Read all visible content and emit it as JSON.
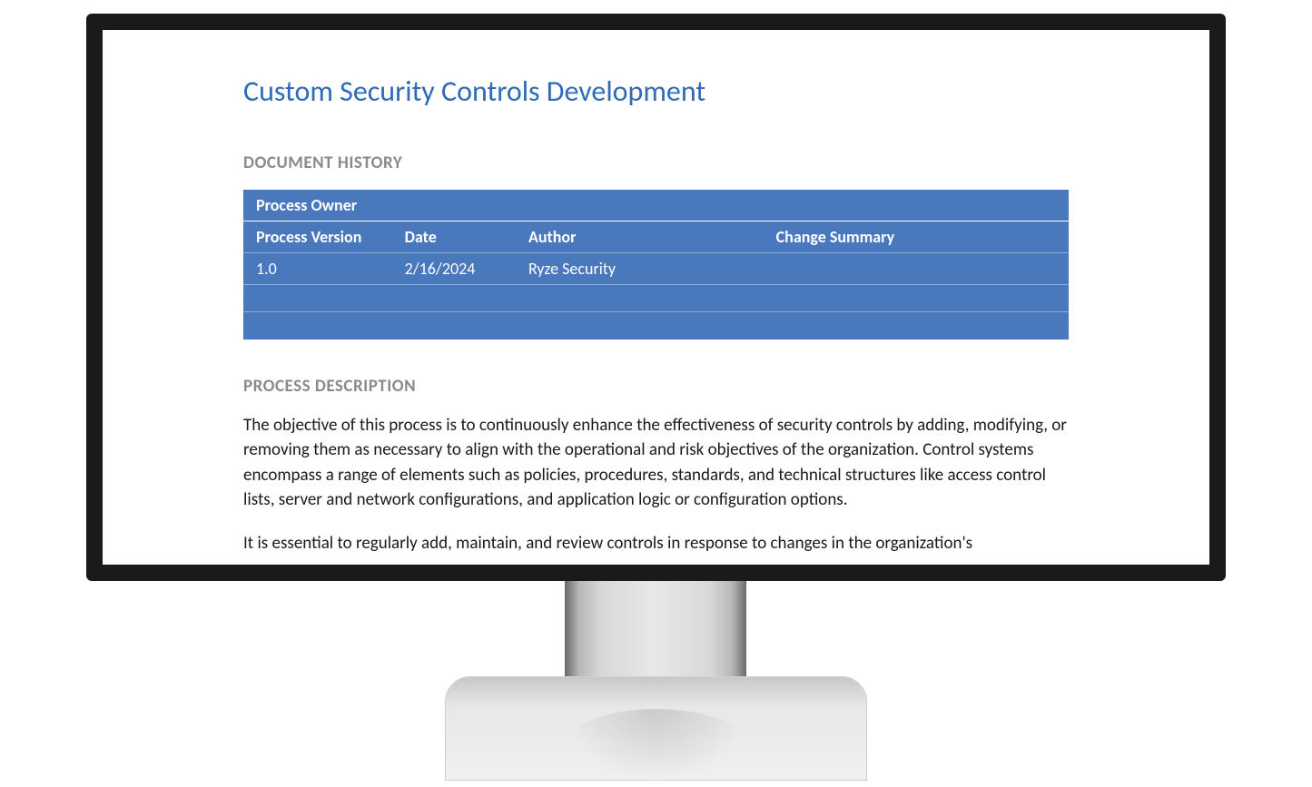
{
  "document": {
    "title": "Custom Security Controls Development",
    "sections": {
      "history": {
        "heading": "DOCUMENT HISTORY",
        "ownerLabel": "Process Owner",
        "columns": {
          "version": "Process Version",
          "date": "Date",
          "author": "Author",
          "summary": "Change Summary"
        },
        "rows": [
          {
            "version": "1.0",
            "date": "2/16/2024",
            "author": "Ryze Security",
            "summary": ""
          }
        ]
      },
      "description": {
        "heading": "PROCESS DESCRIPTION",
        "paragraphs": [
          "The objective of this process is to continuously enhance the effectiveness of security controls by adding, modifying, or removing them as necessary to align with the operational and risk objectives of the organization.  Control systems encompass a range of elements such as policies, procedures, standards, and technical structures like access control lists, server and network configurations, and application logic or configuration options.",
          "It is essential to regularly add, maintain, and review controls in response to changes in the organization's"
        ]
      }
    }
  }
}
